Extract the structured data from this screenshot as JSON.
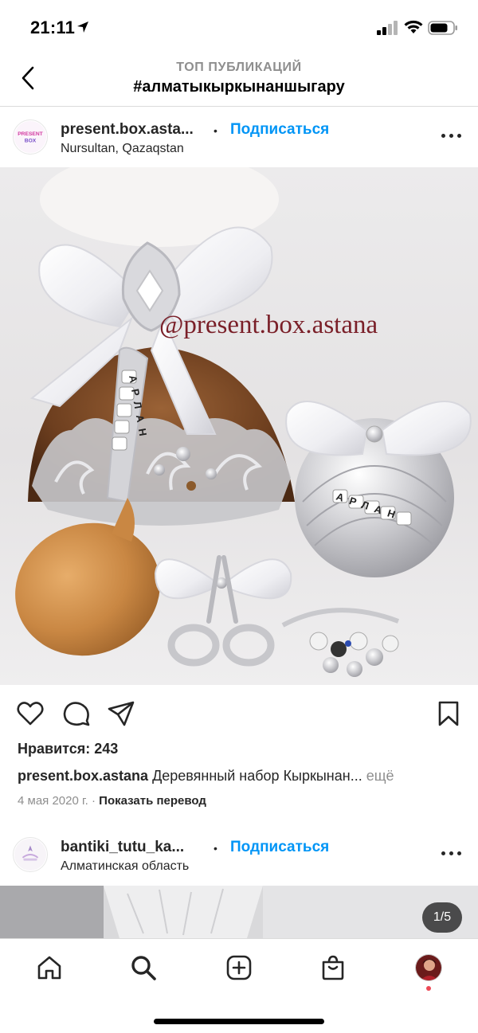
{
  "status": {
    "time": "21:11"
  },
  "header": {
    "subtitle": "ТОП ПУБЛИКАЦИЙ",
    "title": "#алматыкыркынаншыгару"
  },
  "post1": {
    "username": "present.box.asta...",
    "follow_label": "Подписаться",
    "location": "Nursultan, Qazaqstan",
    "avatar_text_line1": "PRESENT",
    "avatar_text_line2": "BOX",
    "watermark": "@present.box.astana",
    "likes": "Нравится: 243",
    "caption_user": "present.box.astana",
    "caption_text": "Деревянный набор Кыркынан...",
    "caption_more": "ещё",
    "date": "4 мая 2020 г.",
    "translate_label": "Показать перевод",
    "spoon_engraving": "АРЛАН",
    "ball_engraving": "АРЛАН"
  },
  "post2": {
    "username": "bantiki_tutu_ka...",
    "follow_label": "Подписаться",
    "location": "Алматинская область",
    "image_counter": "1/5"
  },
  "icons": {
    "back": "chevron-left-icon",
    "like": "heart-icon",
    "comment": "comment-bubble-icon",
    "share": "paper-plane-icon",
    "save": "bookmark-icon",
    "home": "home-icon",
    "search": "search-icon",
    "create": "plus-square-icon",
    "shop": "shopping-bag-icon"
  },
  "colors": {
    "accent": "#0095f6",
    "text": "#262626",
    "muted": "#8e8e8e",
    "notification": "#ed4956"
  }
}
